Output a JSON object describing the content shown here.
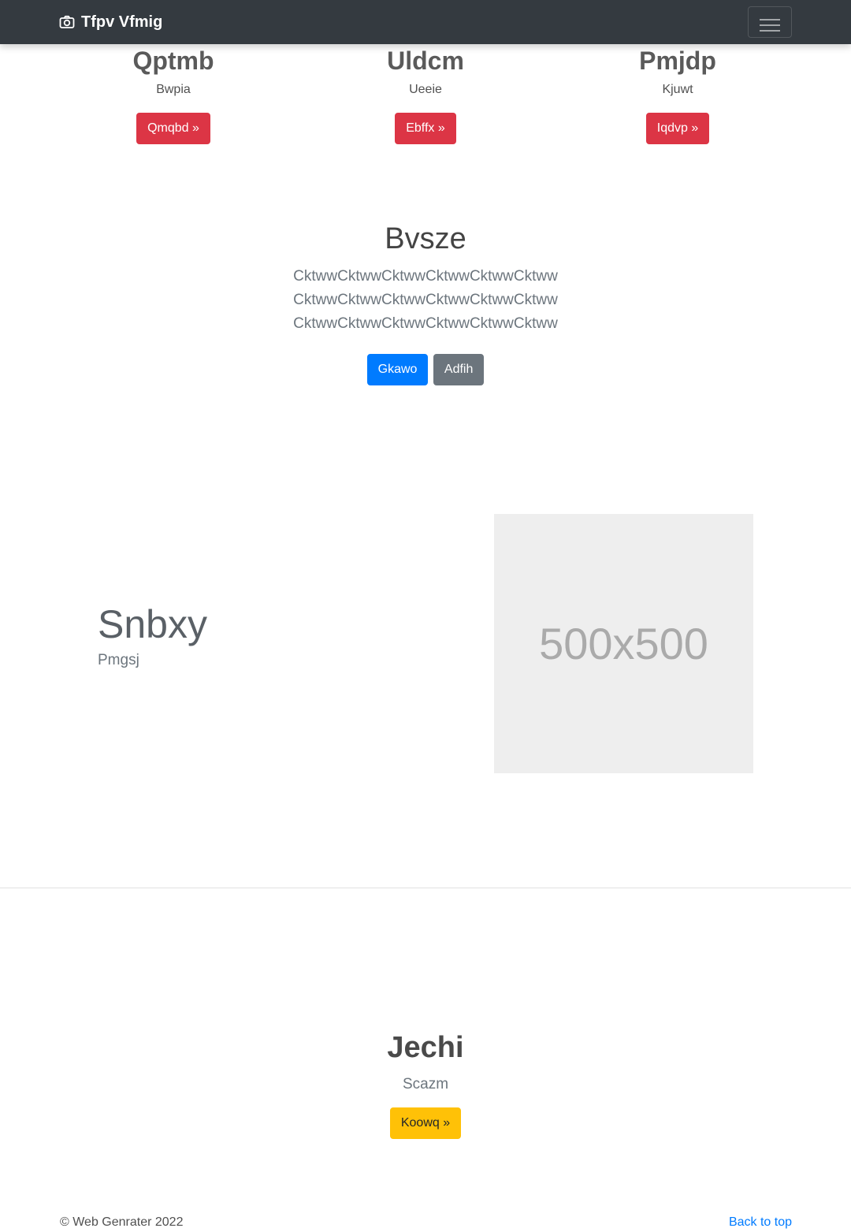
{
  "navbar": {
    "brand": "Tfpv Vfmig",
    "brand_icon": "camera-icon",
    "toggler_icon": "hamburger-icon",
    "bg_color": "#343a40"
  },
  "features": [
    {
      "title": "Qptmb",
      "text": "Bwpia",
      "button": "Qmqbd »"
    },
    {
      "title": "Uldcm",
      "text": "Ueeie",
      "button": "Ebffx »"
    },
    {
      "title": "Pmjdp",
      "text": "Kjuwt",
      "button": "Iqdvp »"
    }
  ],
  "jumbotron": {
    "heading": "Bvsze",
    "lead": "CktwwCktwwCktwwCktwwCktwwCktwwCktwwCktwwCktwwCktwwCktwwCktwwCktwwCktwwCktwwCktwwCktwwCktww",
    "primary_button": "Gkawo",
    "secondary_button": "Adfih"
  },
  "featurette": {
    "heading": "Snbxy",
    "subtext": "Pmgsj",
    "image_placeholder": "500x500"
  },
  "cta": {
    "heading": "Jechi",
    "subtext": "Scazm",
    "button": "Koowq »"
  },
  "footer": {
    "copyright": "© Web Genrater 2022",
    "back_to_top": "Back to top"
  },
  "colors": {
    "danger": "#dc3545",
    "primary": "#007bff",
    "secondary": "#6c757d",
    "warning": "#ffc107"
  }
}
